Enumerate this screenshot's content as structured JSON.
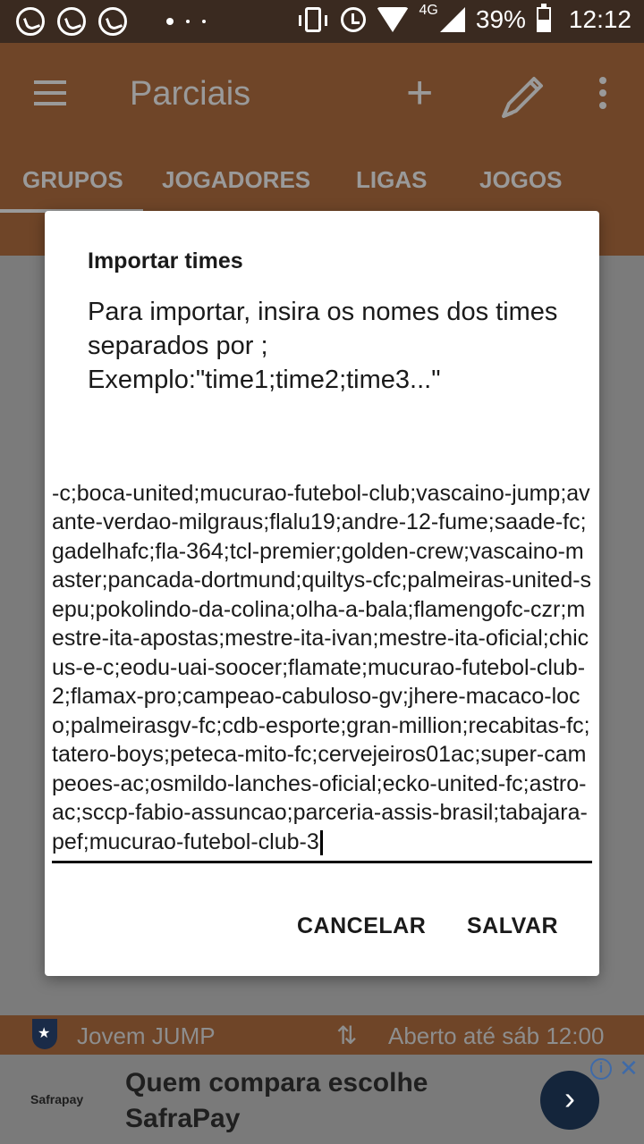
{
  "status_bar": {
    "network": "4G",
    "battery": "39%",
    "time": "12:12"
  },
  "toolbar": {
    "title": "Parciais",
    "add_symbol": "+"
  },
  "tabs": [
    "GRUPOS",
    "JOGADORES",
    "LIGAS",
    "JOGOS"
  ],
  "group_row": {
    "name": "Jovem  JUMP",
    "status": "Aberto  até sáb 12:00"
  },
  "ad": {
    "brand": "Safrapay",
    "text": "Quem compara escolhe SafraPay"
  },
  "dialog": {
    "title": "Importar times",
    "message": "Para importar, insira os nomes dos times separados por ;\nExemplo:\"time1;time2;time3...\"",
    "input_value": "-c;boca-united;mucurao-futebol-club;vascaino-jump;avante-verdao-milgraus;flalu19;andre-12-fume;saade-fc;gadelhafc;fla-364;tcl-premier;golden-crew;vascaino-master;pancada-dortmund;quiltys-cfc;palmeiras-united-sepu;pokolindo-da-colina;olha-a-bala;flamengofc-czr;mestre-ita-apostas;mestre-ita-ivan;mestre-ita-oficial;chicus-e-c;eodu-uai-soocer;flamate;mucurao-futebol-club-2;flamax-pro;campeao-cabuloso-gv;jhere-macaco-loco;palmeirasgv-fc;cdb-esporte;gran-million;recabitas-fc;tatero-boys;peteca-mito-fc;cervejeiros01ac;super-campeoes-ac;osmildo-lanches-oficial;ecko-united-fc;astro-ac;sccp-fabio-assuncao;parceria-assis-brasil;tabajara-pef;mucurao-futebol-club-3",
    "cancel_label": "CANCELAR",
    "save_label": "SALVAR"
  }
}
